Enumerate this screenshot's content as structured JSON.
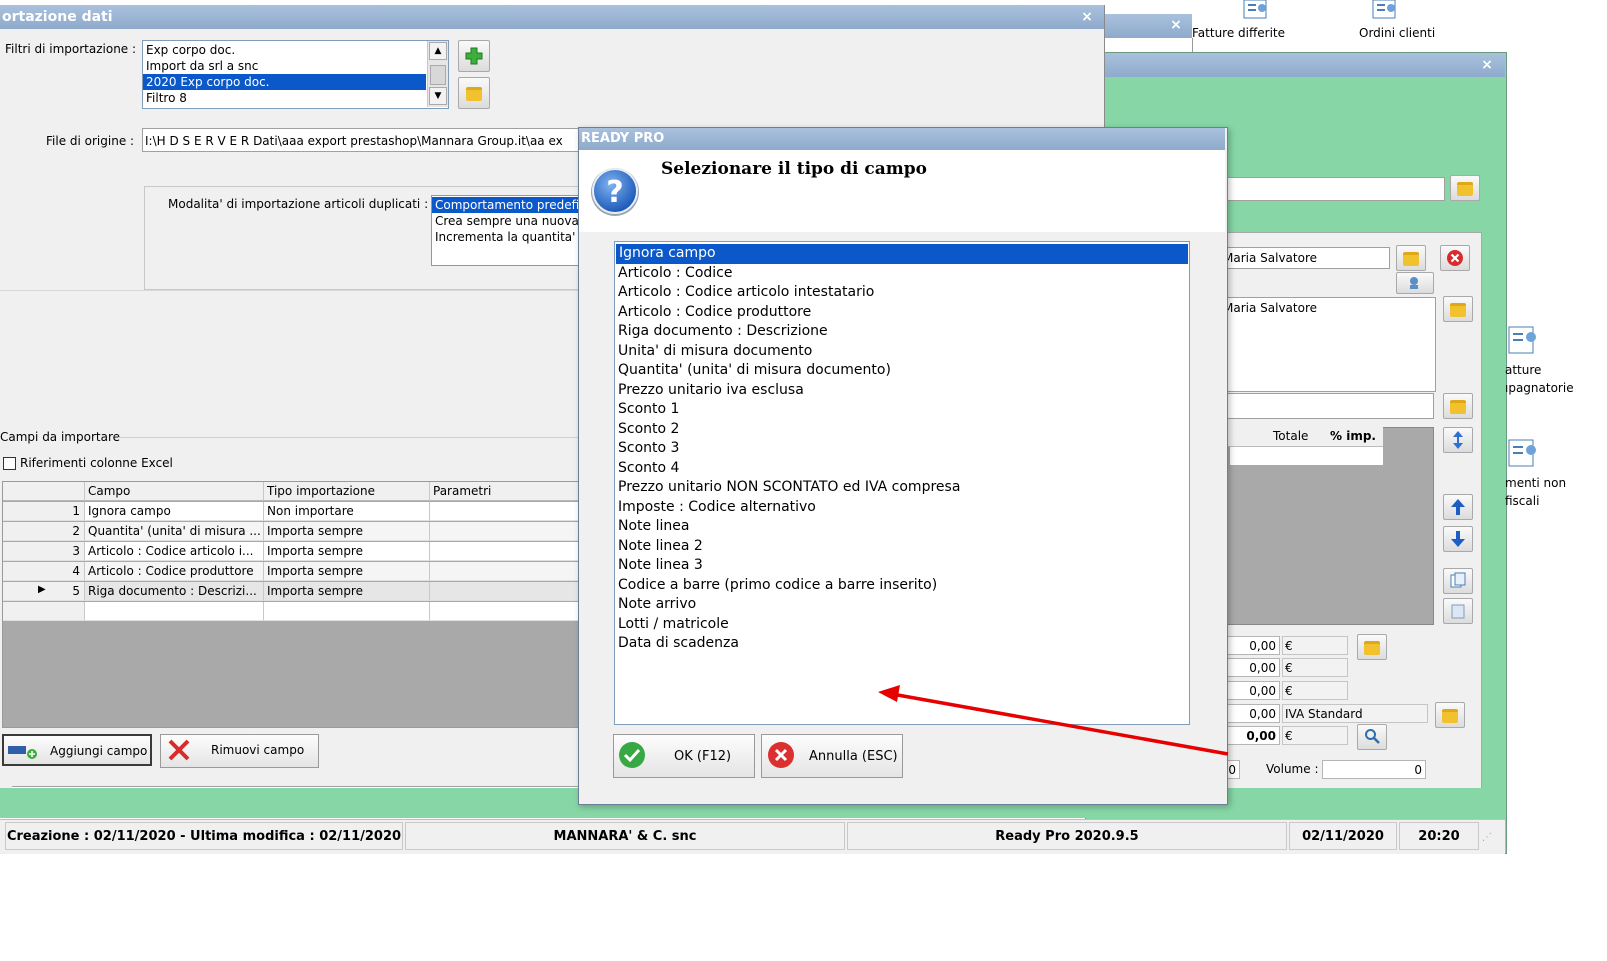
{
  "top_icons": [
    {
      "label": "Fatture differite",
      "icon": "document-user-icon"
    },
    {
      "label": "Ordini clienti",
      "icon": "document-user-icon"
    }
  ],
  "right_icons": [
    {
      "label1": "atture",
      "label2": "ıpagnatorie"
    },
    {
      "label1": "menti non",
      "label2": "fiscali"
    }
  ],
  "import_window": {
    "title": "ortazione dati",
    "filters_label": "Filtri di importazione :",
    "filters": [
      "Exp corpo doc.",
      "Import da srl a snc",
      "2020 Exp corpo doc.",
      "Filtro 8"
    ],
    "selected_filter_index": 2,
    "file_label": "File di origine :",
    "file_value": "I:\\H D  S E R V E R  Dati\\aaa export prestashop\\Mannara Group.it\\aa ex",
    "dup_label": "Modalita' di importazione articoli duplicati :",
    "dup_options": [
      "Comportamento predefi",
      "Crea sempre una nuova",
      "Incrementa la quantita'"
    ],
    "fields_group": "Campi da importare",
    "excel_ref": "Riferimenti colonne Excel",
    "columns": [
      "Campo",
      "Tipo importazione",
      "Parametri"
    ],
    "rows": [
      {
        "n": "1",
        "campo": "Ignora campo",
        "tipo": "Non importare"
      },
      {
        "n": "2",
        "campo": "Quantita' (unita' di misura ...",
        "tipo": "Importa sempre"
      },
      {
        "n": "3",
        "campo": "Articolo : Codice articolo i...",
        "tipo": "Importa sempre"
      },
      {
        "n": "4",
        "campo": "Articolo : Codice produttore",
        "tipo": "Importa sempre"
      },
      {
        "n": "5",
        "campo": "Riga documento : Descrizi...",
        "tipo": "Importa sempre"
      }
    ],
    "add_button": "Aggiungi campo",
    "remove_button": "Rimuovi campo"
  },
  "document_window": {
    "customer_name": "Maria Salvatore",
    "customer_name2": "Maria Salvatore",
    "col_totale": "Totale",
    "col_imp": "% imp.",
    "totals": [
      {
        "value": "0,00",
        "unit": "€"
      },
      {
        "value": "0,00",
        "unit": "€"
      },
      {
        "value": "0,00",
        "unit": "€"
      },
      {
        "value": "0,00",
        "unit": "IVA Standard"
      },
      {
        "value": "0,00",
        "unit": "€"
      }
    ],
    "left_value": "0",
    "volume_label": "Volume :",
    "volume_value": "0"
  },
  "dialog": {
    "app_title": "READY PRO",
    "heading": "Selezionare il tipo di campo",
    "options": [
      "Ignora campo",
      "Articolo : Codice",
      "Articolo : Codice articolo intestatario",
      "Articolo : Codice produttore",
      "Riga documento : Descrizione",
      "Unita' di misura documento",
      "Quantita' (unita' di misura documento)",
      "Prezzo unitario iva esclusa",
      "Sconto 1",
      "Sconto 2",
      "Sconto 3",
      "Sconto 4",
      "Prezzo unitario NON SCONTATO ed IVA compresa",
      "Imposte : Codice alternativo",
      "Note linea",
      "Note linea 2",
      "Note linea 3",
      "Codice a barre (primo codice a barre inserito)",
      "Note arrivo",
      "Lotti / matricole",
      "Data di scadenza"
    ],
    "selected_index": 0,
    "ok_button": "OK (F12)",
    "cancel_button": "Annulla (ESC)"
  },
  "statusbar": {
    "created": "Creazione : 02/11/2020 - Ultima modifica : 02/11/2020",
    "company": "MANNARA' & C. snc",
    "version": "Ready Pro 2020.9.5",
    "date": "02/11/2020",
    "time": "20:20"
  },
  "colors": {
    "green_bg": "#86d6a6",
    "title_blue": "#9bb5d4",
    "selection": "#0a58ca",
    "arrow_red": "#e60000"
  }
}
